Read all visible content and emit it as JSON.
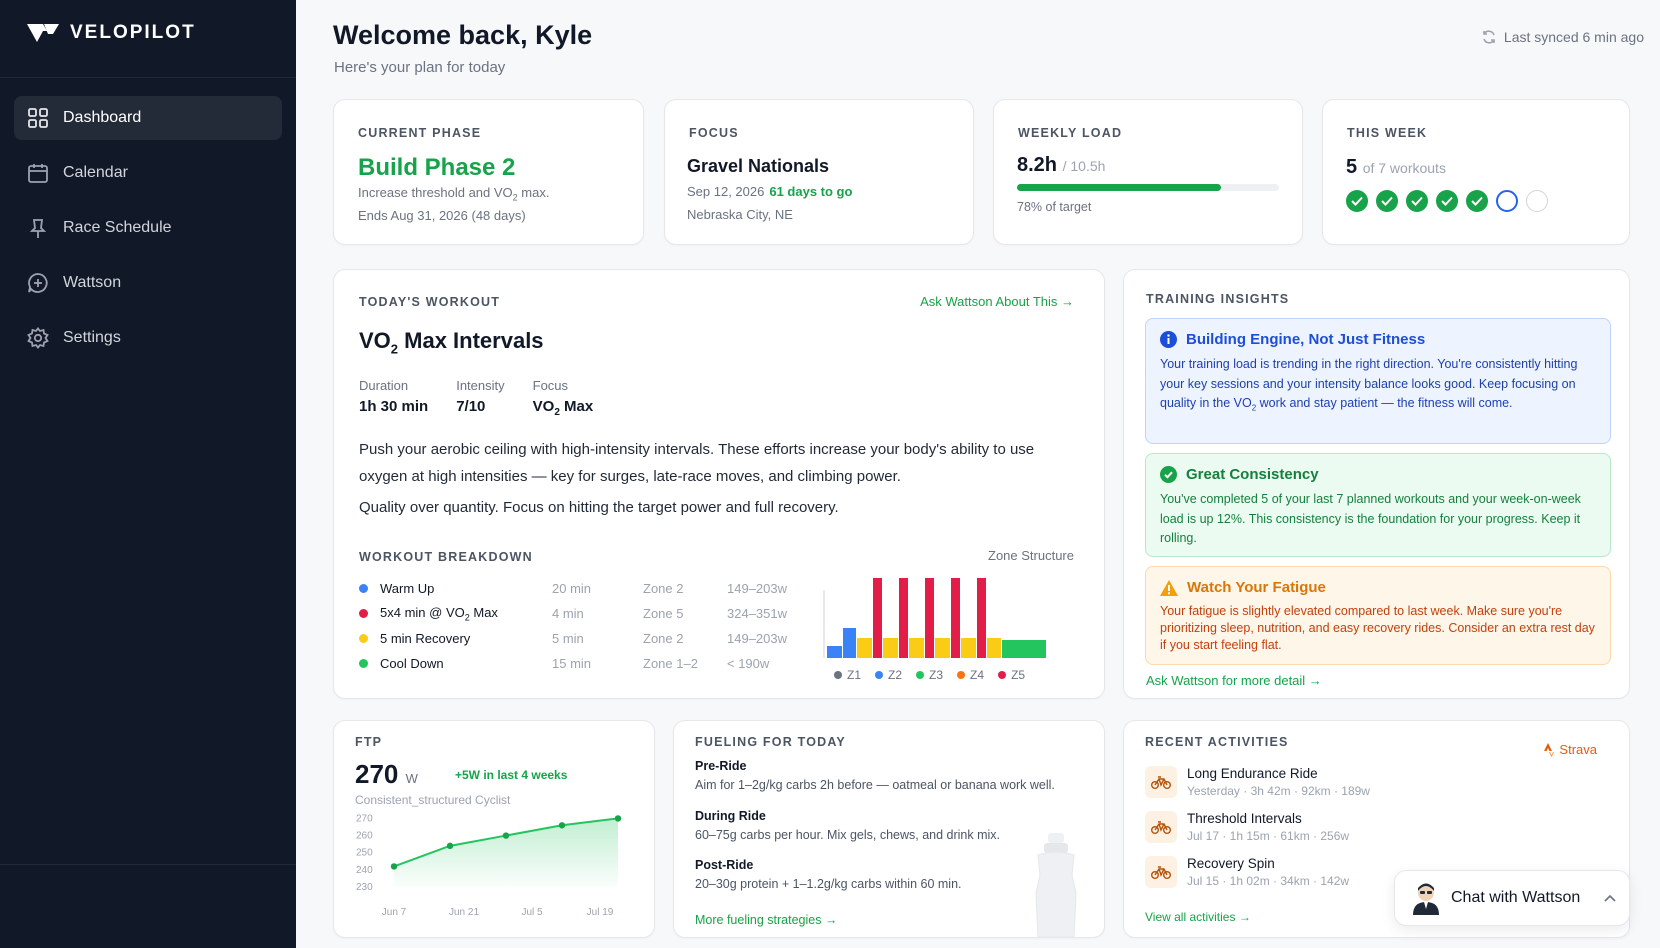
{
  "brand": "VELOPILOT",
  "nav": [
    {
      "label": "Dashboard",
      "icon": "grid-icon",
      "active": true
    },
    {
      "label": "Calendar",
      "icon": "calendar-icon"
    },
    {
      "label": "Race Schedule",
      "icon": "pin-icon"
    },
    {
      "label": "Wattson",
      "icon": "chat-icon"
    },
    {
      "label": "Settings",
      "icon": "gear-icon"
    }
  ],
  "header": {
    "title": "Welcome back, Kyle",
    "subtitle": "Here's your plan for today",
    "sync": "Last synced 6 min ago"
  },
  "phase": {
    "label": "CURRENT PHASE",
    "title": "Build Phase 2",
    "desc_pre": "Increase threshold and VO",
    "desc_sub": "2",
    "desc_post": " max.",
    "ends": "Ends Aug 31, 2026 (48 days)"
  },
  "focus": {
    "label": "FOCUS",
    "title": "Gravel Nationals",
    "date": "Sep 12, 2026",
    "countdown": "61 days to go",
    "location": "Nebraska City, NE"
  },
  "load": {
    "label": "WEEKLY LOAD",
    "value": "8.2h",
    "target": "/ 10.5h",
    "fraction": 0.78,
    "note": "78% of target"
  },
  "week": {
    "label": "THIS WEEK",
    "done": "5",
    "of": "of 7 workouts",
    "statuses": [
      "done",
      "done",
      "done",
      "done",
      "done",
      "current",
      "empty"
    ]
  },
  "workout": {
    "label": "TODAY'S WORKOUT",
    "ask": "Ask Wattson About This →",
    "title_pre": "VO",
    "title_sub": "2",
    "title_post": " Max Intervals",
    "meta": {
      "duration_k": "Duration",
      "duration_v": "1h 30 min",
      "intensity_k": "Intensity",
      "intensity_v": "7/10",
      "focus_k": "Focus",
      "focus_v_pre": "VO",
      "focus_v_sub": "2",
      "focus_v_post": " Max"
    },
    "desc": "Push your aerobic ceiling with high-intensity intervals. These efforts increase your body's ability to use oxygen at high intensities — key for surges, late-race moves, and climbing power.",
    "desc2": "Quality over quantity. Focus on hitting the target power and full recovery.",
    "breakdown_label": "WORKOUT BREAKDOWN",
    "zone_label": "Zone Structure",
    "steps": [
      {
        "name": "Warm Up",
        "dur": "20 min",
        "zone": "Zone 2",
        "power": "149–203w",
        "color": "#3b82f6"
      },
      {
        "name_pre": "5x4 min @ VO",
        "name_sub": "2",
        "name_post": " Max",
        "dur": "4 min",
        "zone": "Zone 5",
        "power": "324–351w",
        "color": "#e11d48"
      },
      {
        "name": "5 min Recovery",
        "dur": "5 min",
        "zone": "Zone 2",
        "power": "149–203w",
        "color": "#facc15"
      },
      {
        "name": "Cool Down",
        "dur": "15 min",
        "zone": "Zone 1–2",
        "power": "< 190w",
        "color": "#22c55e"
      }
    ],
    "zones": [
      "Z1",
      "Z2",
      "Z3",
      "Z4",
      "Z5"
    ],
    "zone_colors": [
      "#6b7280",
      "#3b82f6",
      "#22c55e",
      "#f97316",
      "#e11d48"
    ]
  },
  "insights": {
    "label": "TRAINING INSIGHTS",
    "blue": {
      "title": "Building Engine, Not Just Fitness",
      "body_pre": "Your training load is trending in the right direction. You're consistently hitting your key sessions and your intensity balance looks good. Keep focusing on quality in the VO",
      "body_sub": "2",
      "body_post": " work and stay patient — the fitness will come."
    },
    "green": {
      "title": "Great Consistency",
      "body": "You've completed 5 of your last 7 planned workouts and your week-on-week load is up 12%. This consistency is the foundation for your progress. Keep it rolling."
    },
    "orange": {
      "title": "Watch Your Fatigue",
      "body": "Your fatigue is slightly elevated compared to last week. Make sure you're prioritizing sleep, nutrition, and easy recovery rides. Consider an extra rest day if you start feeling flat."
    },
    "more": "Ask Wattson for more detail →"
  },
  "ftp": {
    "label": "FTP",
    "value": "270",
    "unit": "W",
    "delta": "+5W in last 4 weeks",
    "note": "Consistent_structured Cyclist",
    "chart_data": {
      "type": "area",
      "x": [
        "Jun 7",
        "Jun 21",
        "Jul 5",
        "Jul 19"
      ],
      "y_ticks": [
        "270",
        "260",
        "250",
        "240",
        "230"
      ],
      "ylim": [
        230,
        272
      ],
      "points": [
        {
          "x": "Jun 7",
          "y": 242
        },
        {
          "x": "Jun 14",
          "y": 254
        },
        {
          "x": "Jul 1",
          "y": 260
        },
        {
          "x": "Jul 12",
          "y": 266
        },
        {
          "x": "Jul 23",
          "y": 270
        }
      ]
    }
  },
  "fueling": {
    "label": "FUELING FOR TODAY",
    "pre_t": "Pre-Ride",
    "pre_d": "Aim for 1–2g/kg carbs 2h before — oatmeal or banana work well.",
    "during_t": "During Ride",
    "during_d": "60–75g carbs per hour. Mix gels, chews, and drink mix.",
    "post_t": "Post-Ride",
    "post_d": "20–30g protein + 1–1.2g/kg carbs within 60 min.",
    "more": "More fueling strategies →"
  },
  "activities": {
    "label": "RECENT ACTIVITIES",
    "source": "Strava",
    "items": [
      {
        "name": "Long Endurance Ride",
        "meta": "Yesterday · 3h 42m · 92km · 189w"
      },
      {
        "name": "Threshold Intervals",
        "meta": "Jul 17 · 1h 15m · 61km · 256w"
      },
      {
        "name": "Recovery Spin",
        "meta": "Jul 15 · 1h 02m · 34km · 142w"
      }
    ],
    "more": "View all activities →"
  },
  "chat": {
    "label": "Chat with Wattson"
  }
}
